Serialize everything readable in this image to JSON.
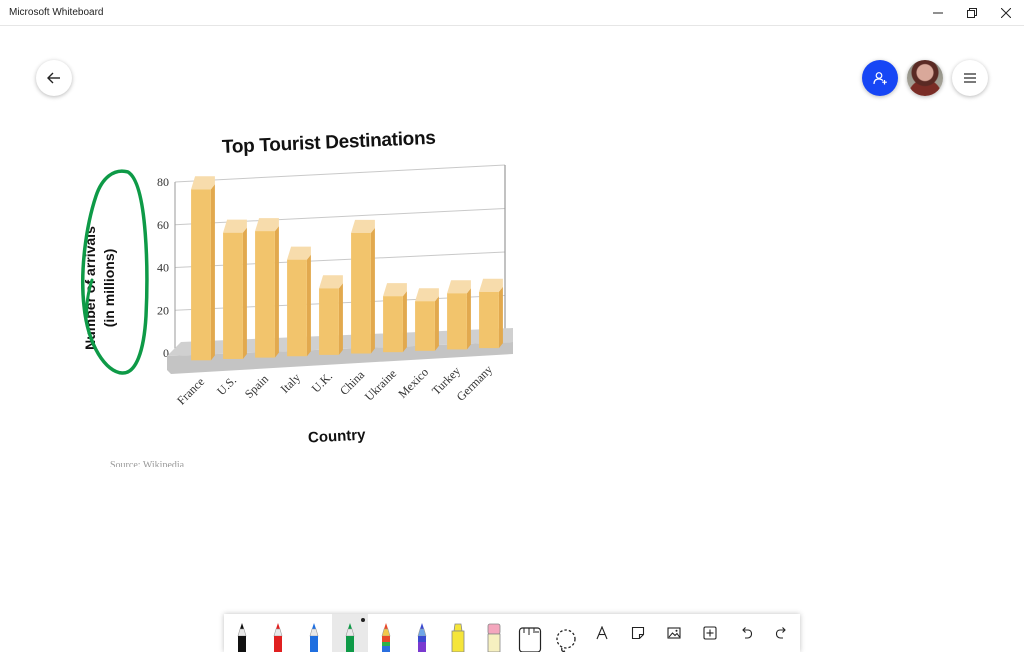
{
  "window": {
    "title": "Microsoft Whiteboard"
  },
  "chart_data": {
    "type": "bar",
    "title": "Top Tourist Destinations",
    "xlabel": "Country",
    "ylabel_line1": "Number of arrivals",
    "ylabel_line2": "(in millions)",
    "categories": [
      "France",
      "U.S.",
      "Spain",
      "Italy",
      "U.K.",
      "China",
      "Ukraine",
      "Mexico",
      "Turkey",
      "Germany"
    ],
    "values": [
      79,
      58,
      58,
      44,
      30,
      55,
      25,
      22,
      25,
      25
    ],
    "ylim": [
      0,
      80
    ],
    "yticks": [
      "0",
      "20",
      "40",
      "60",
      "80"
    ],
    "grid": true,
    "bar_color": "#f2c46c",
    "bar_top_color": "#f7dcac",
    "bar_side_color": "#e2a94e",
    "floor_color": "#d0d0d0",
    "source": "Source: Wikipedia"
  },
  "annotation": {
    "ink_color": "#0e9a47"
  },
  "toolbar": {
    "tools": [
      {
        "name": "black-pen",
        "color": "#111111"
      },
      {
        "name": "red-pen",
        "color": "#e02020"
      },
      {
        "name": "blue-pen",
        "color": "#1f6fe0"
      },
      {
        "name": "green-pen",
        "color": "#0e9a47"
      },
      {
        "name": "rainbow-pen",
        "color": "#e84a2a"
      },
      {
        "name": "galaxy-pen",
        "color": "#3a4ad0"
      },
      {
        "name": "highlighter",
        "color": "#f5e53a"
      },
      {
        "name": "eraser",
        "color": "#f4a6bd"
      }
    ]
  }
}
